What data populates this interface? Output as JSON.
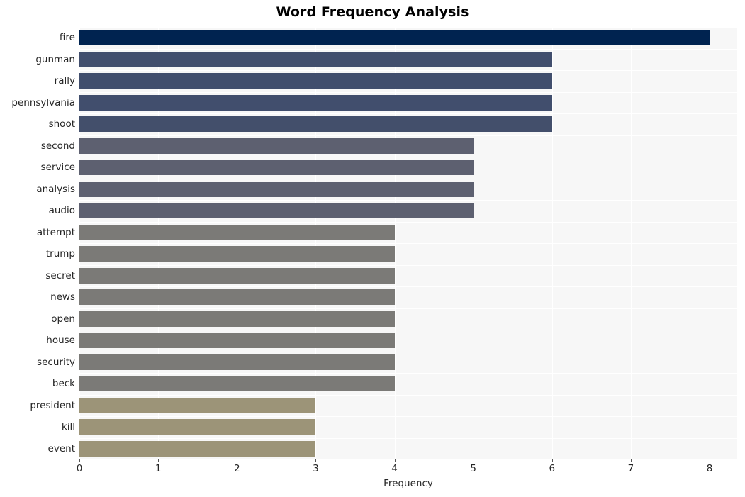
{
  "chart_data": {
    "type": "bar",
    "orientation": "horizontal",
    "title": "Word Frequency Analysis",
    "xlabel": "Frequency",
    "ylabel": "",
    "xlim": [
      0,
      8.35
    ],
    "xticks": [
      0,
      1,
      2,
      3,
      4,
      5,
      6,
      7,
      8
    ],
    "xtick_labels": [
      "0",
      "1",
      "2",
      "3",
      "4",
      "5",
      "6",
      "7",
      "8"
    ],
    "grid": true,
    "legend": null,
    "categories": [
      "fire",
      "gunman",
      "rally",
      "pennsylvania",
      "shoot",
      "second",
      "service",
      "analysis",
      "audio",
      "attempt",
      "trump",
      "secret",
      "news",
      "open",
      "house",
      "security",
      "beck",
      "president",
      "kill",
      "event"
    ],
    "values": [
      8,
      6,
      6,
      6,
      6,
      5,
      5,
      5,
      5,
      4,
      4,
      4,
      4,
      4,
      4,
      4,
      4,
      3,
      3,
      3
    ],
    "bar_colors": [
      "#002350",
      "#414e6d",
      "#414e6d",
      "#414e6d",
      "#434f6b",
      "#5d6070",
      "#5d6070",
      "#5d6070",
      "#5d6070",
      "#7b7a77",
      "#7b7a77",
      "#7b7a77",
      "#7b7a77",
      "#7b7a77",
      "#7b7a77",
      "#7b7a77",
      "#7b7a77",
      "#9c9478",
      "#9c9478",
      "#9c9478"
    ],
    "plot_background": "#f7f7f7",
    "gridline_color": "#ffffff",
    "title_color": "#000000",
    "tick_label_color": "#262626"
  }
}
